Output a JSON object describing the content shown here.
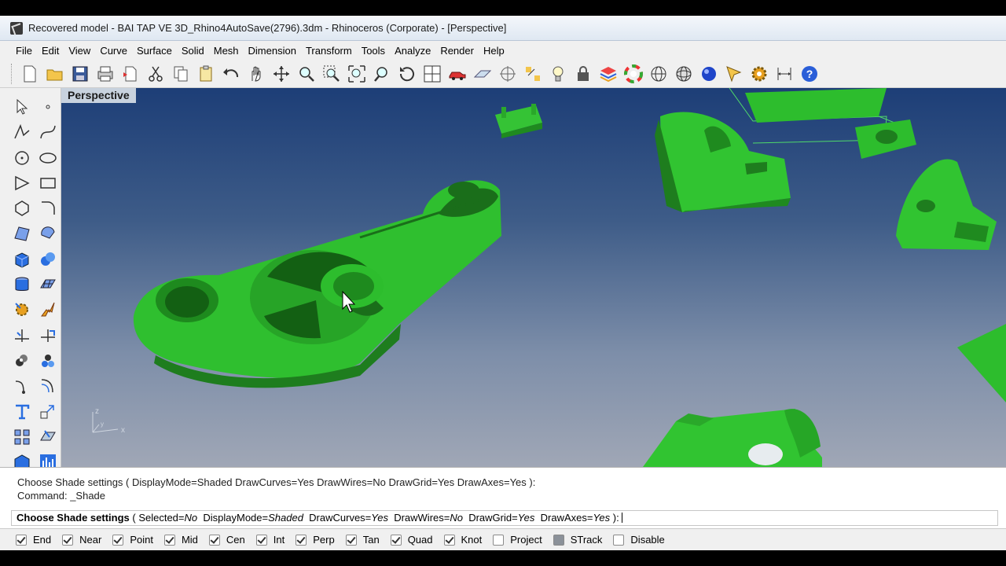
{
  "window": {
    "title": "Recovered model - BAI TAP VE 3D_Rhino4AutoSave(2796).3dm - Rhinoceros (Corporate) - [Perspective]"
  },
  "menubar": {
    "items": [
      "File",
      "Edit",
      "View",
      "Curve",
      "Surface",
      "Solid",
      "Mesh",
      "Dimension",
      "Transform",
      "Tools",
      "Analyze",
      "Render",
      "Help"
    ]
  },
  "toolbar": {
    "icons": [
      "new-file-icon",
      "open-folder-icon",
      "save-icon",
      "print-icon",
      "import-icon",
      "cut-icon",
      "copy-icon",
      "paste-icon",
      "undo-icon",
      "pan-hand-icon",
      "rotate-view-icon",
      "zoom-dynamic-icon",
      "zoom-window-icon",
      "zoom-extents-icon",
      "zoom-selected-icon",
      "undo-view-icon",
      "four-viewports-icon",
      "car-render-icon",
      "cplane-icon",
      "grid-snap-icon",
      "object-snap-icon",
      "lights-icon",
      "lock-icon",
      "layers-icon",
      "color-wheel-icon",
      "wireframe-sphere-icon",
      "ghosted-sphere-icon",
      "shaded-sphere-icon",
      "select-filter-icon",
      "settings-gear-icon",
      "dimension-icon",
      "help-icon"
    ]
  },
  "viewport": {
    "label": "Perspective",
    "axes": {
      "x": "x",
      "y": "y",
      "z": "z"
    }
  },
  "command": {
    "history": [
      "Choose Shade settings ( DisplayMode=Shaded  DrawCurves=Yes  DrawWires=No  DrawGrid=Yes  DrawAxes=Yes ):",
      "Command: _Shade"
    ],
    "prompt_lead": "Choose Shade settings",
    "prompt_paren_open": " ( ",
    "options": [
      {
        "label": "Selected=",
        "value": "No"
      },
      {
        "label": "DisplayMode=",
        "value": "Shaded"
      },
      {
        "label": "DrawCurves=",
        "value": "Yes"
      },
      {
        "label": "DrawWires=",
        "value": "No"
      },
      {
        "label": "DrawGrid=",
        "value": "Yes"
      },
      {
        "label": "DrawAxes=",
        "value": "Yes"
      }
    ],
    "prompt_close": " ):"
  },
  "statusbar": {
    "osnaps": [
      {
        "label": "End",
        "checked": true
      },
      {
        "label": "Near",
        "checked": true
      },
      {
        "label": "Point",
        "checked": true
      },
      {
        "label": "Mid",
        "checked": true
      },
      {
        "label": "Cen",
        "checked": true
      },
      {
        "label": "Int",
        "checked": true
      },
      {
        "label": "Perp",
        "checked": true
      },
      {
        "label": "Tan",
        "checked": true
      },
      {
        "label": "Quad",
        "checked": true
      },
      {
        "label": "Knot",
        "checked": true
      },
      {
        "label": "Project",
        "checked": false
      },
      {
        "label": "STrack",
        "checked": false
      },
      {
        "label": "Disable",
        "checked": false
      }
    ]
  },
  "colors": {
    "model_green": "#2fbf2f",
    "model_dark": "#1e7d1e",
    "viewport_top": "#1d3e77",
    "viewport_bottom": "#a0a7b6"
  }
}
